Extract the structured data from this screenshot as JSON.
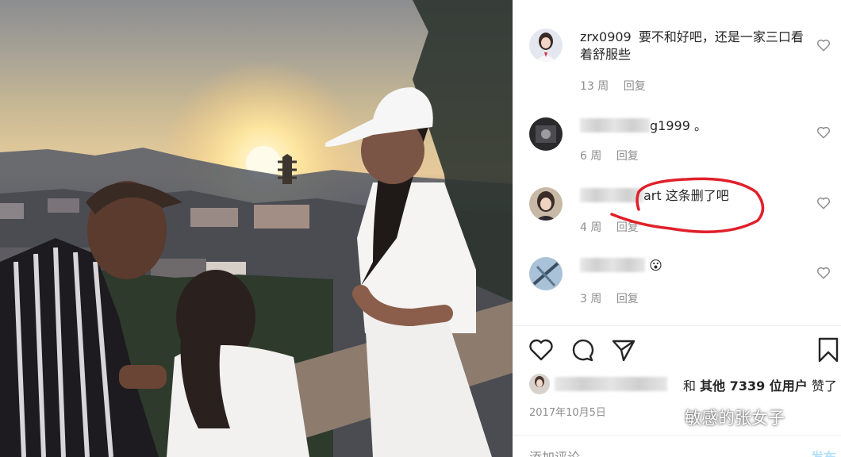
{
  "comments": [
    {
      "user": "zrx0909",
      "text": "要不和好吧，还是一家三口看着舒服些",
      "time": "13 周",
      "reply": "回复"
    },
    {
      "user_suffix": "g1999",
      "text": "。",
      "time": "6 周",
      "reply": "回复"
    },
    {
      "user_suffix": "art",
      "text": "这条删了吧",
      "time": "4 周",
      "reply": "回复"
    },
    {
      "user_suffix": "",
      "text": "😮",
      "time": "3 周",
      "reply": "回复"
    }
  ],
  "likes": {
    "conj": "和",
    "others": "其他 7339 位用户",
    "verb": "赞了"
  },
  "date": "2017年10月5日",
  "watermark": "敏感的张女子",
  "add_comment": {
    "placeholder": "添加评论",
    "post": "发布"
  },
  "colors": {
    "highlight_circle": "#e0202a",
    "link": "#b2dffc"
  },
  "icons": [
    "heart-icon",
    "comment-icon",
    "share-icon",
    "bookmark-icon",
    "wechat-icon"
  ]
}
